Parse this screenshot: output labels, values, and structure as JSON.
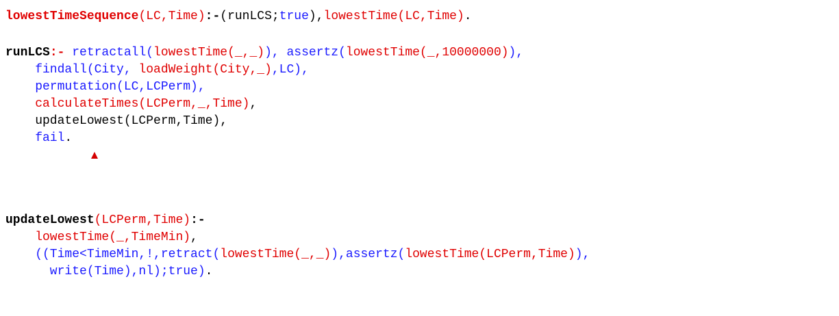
{
  "colors": {
    "default": "#000000",
    "head_bold": "#000000",
    "head_red_bold": "#e00000",
    "predicate": "#e00000",
    "builtin": "#1a1aff",
    "error_marker": "#d40000"
  },
  "code": {
    "lines": [
      {
        "tokens": [
          {
            "t": "lowestTimeSequence",
            "c": "head_red_bold",
            "b": true
          },
          {
            "t": "(LC,Time)",
            "c": "predicate"
          },
          {
            "t": ":-",
            "c": "default",
            "b": true
          },
          {
            "t": "(runLCS;",
            "c": "default"
          },
          {
            "t": "true",
            "c": "builtin"
          },
          {
            "t": "),",
            "c": "default"
          },
          {
            "t": "lowestTime(LC,Time)",
            "c": "predicate"
          },
          {
            "t": ".",
            "c": "default"
          }
        ]
      },
      {
        "tokens": [
          {
            "t": "runLCS",
            "c": "head_bold",
            "b": true
          },
          {
            "t": ":-",
            "c": "head_red_bold",
            "b": true
          },
          {
            "t": " retractall(",
            "c": "builtin"
          },
          {
            "t": "lowestTime(_,_)",
            "c": "predicate"
          },
          {
            "t": "), ",
            "c": "builtin"
          },
          {
            "t": "assertz(",
            "c": "builtin"
          },
          {
            "t": "lowestTime(_,10000000)",
            "c": "predicate"
          },
          {
            "t": "),",
            "c": "builtin"
          }
        ]
      },
      {
        "tokens": [
          {
            "t": "    findall(City, ",
            "c": "builtin"
          },
          {
            "t": "loadWeight(City,_)",
            "c": "predicate"
          },
          {
            "t": ",LC),",
            "c": "builtin"
          }
        ]
      },
      {
        "tokens": [
          {
            "t": "    permutation(LC,LCPerm),",
            "c": "builtin"
          }
        ]
      },
      {
        "tokens": [
          {
            "t": "    calculateTimes(LCPerm,_,Time)",
            "c": "predicate"
          },
          {
            "t": ",",
            "c": "default"
          }
        ]
      },
      {
        "tokens": [
          {
            "t": "    updateLowest(LCPerm,Time),",
            "c": "default"
          }
        ]
      },
      {
        "tokens": [
          {
            "t": "    fail",
            "c": "builtin"
          },
          {
            "t": ".",
            "c": "default"
          }
        ]
      },
      {
        "tokens": [
          {
            "t": "updateLowest",
            "c": "head_bold",
            "b": true
          },
          {
            "t": "(LCPerm,Time)",
            "c": "predicate"
          },
          {
            "t": ":-",
            "c": "default",
            "b": true
          }
        ]
      },
      {
        "tokens": [
          {
            "t": "    lowestTime(_,TimeMin)",
            "c": "predicate"
          },
          {
            "t": ",",
            "c": "default"
          }
        ]
      },
      {
        "tokens": [
          {
            "t": "    ((Time<TimeMin,!,retract(",
            "c": "builtin"
          },
          {
            "t": "lowestTime(_,_)",
            "c": "predicate"
          },
          {
            "t": "),assertz(",
            "c": "builtin"
          },
          {
            "t": "lowestTime(LCPerm,Time)",
            "c": "predicate"
          },
          {
            "t": "),",
            "c": "builtin"
          }
        ]
      },
      {
        "tokens": [
          {
            "t": "      write(Time),nl);true)",
            "c": "builtin"
          },
          {
            "t": ".",
            "c": "default"
          }
        ]
      }
    ]
  }
}
